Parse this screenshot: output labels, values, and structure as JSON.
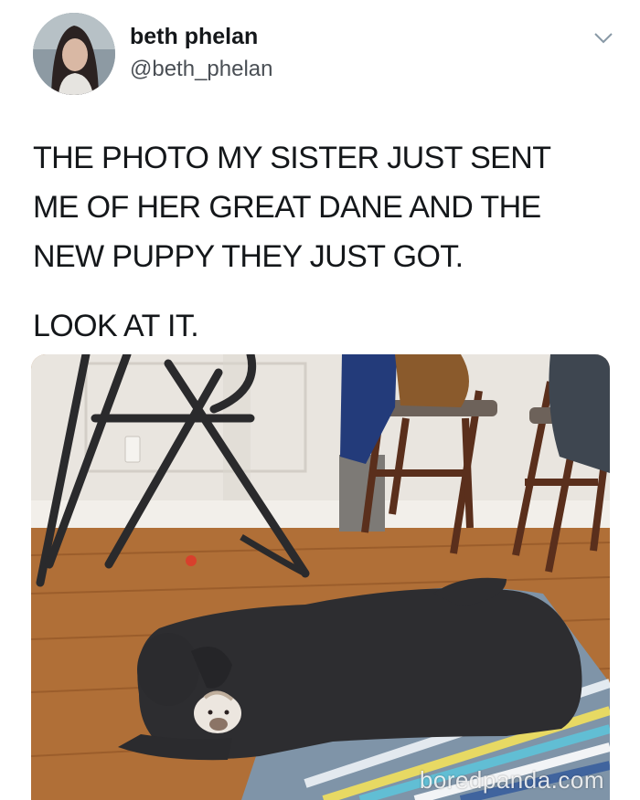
{
  "tweet": {
    "display_name": "beth phelan",
    "handle": "@beth_phelan",
    "paragraphs": [
      "THE PHOTO MY SISTER JUST SENT ME OF HER GREAT DANE AND THE NEW PUPPY THEY JUST GOT.",
      "LOOK AT IT."
    ],
    "menu_icon": "chevron-down-icon"
  },
  "media": {
    "watermark": "boredpanda.com"
  }
}
